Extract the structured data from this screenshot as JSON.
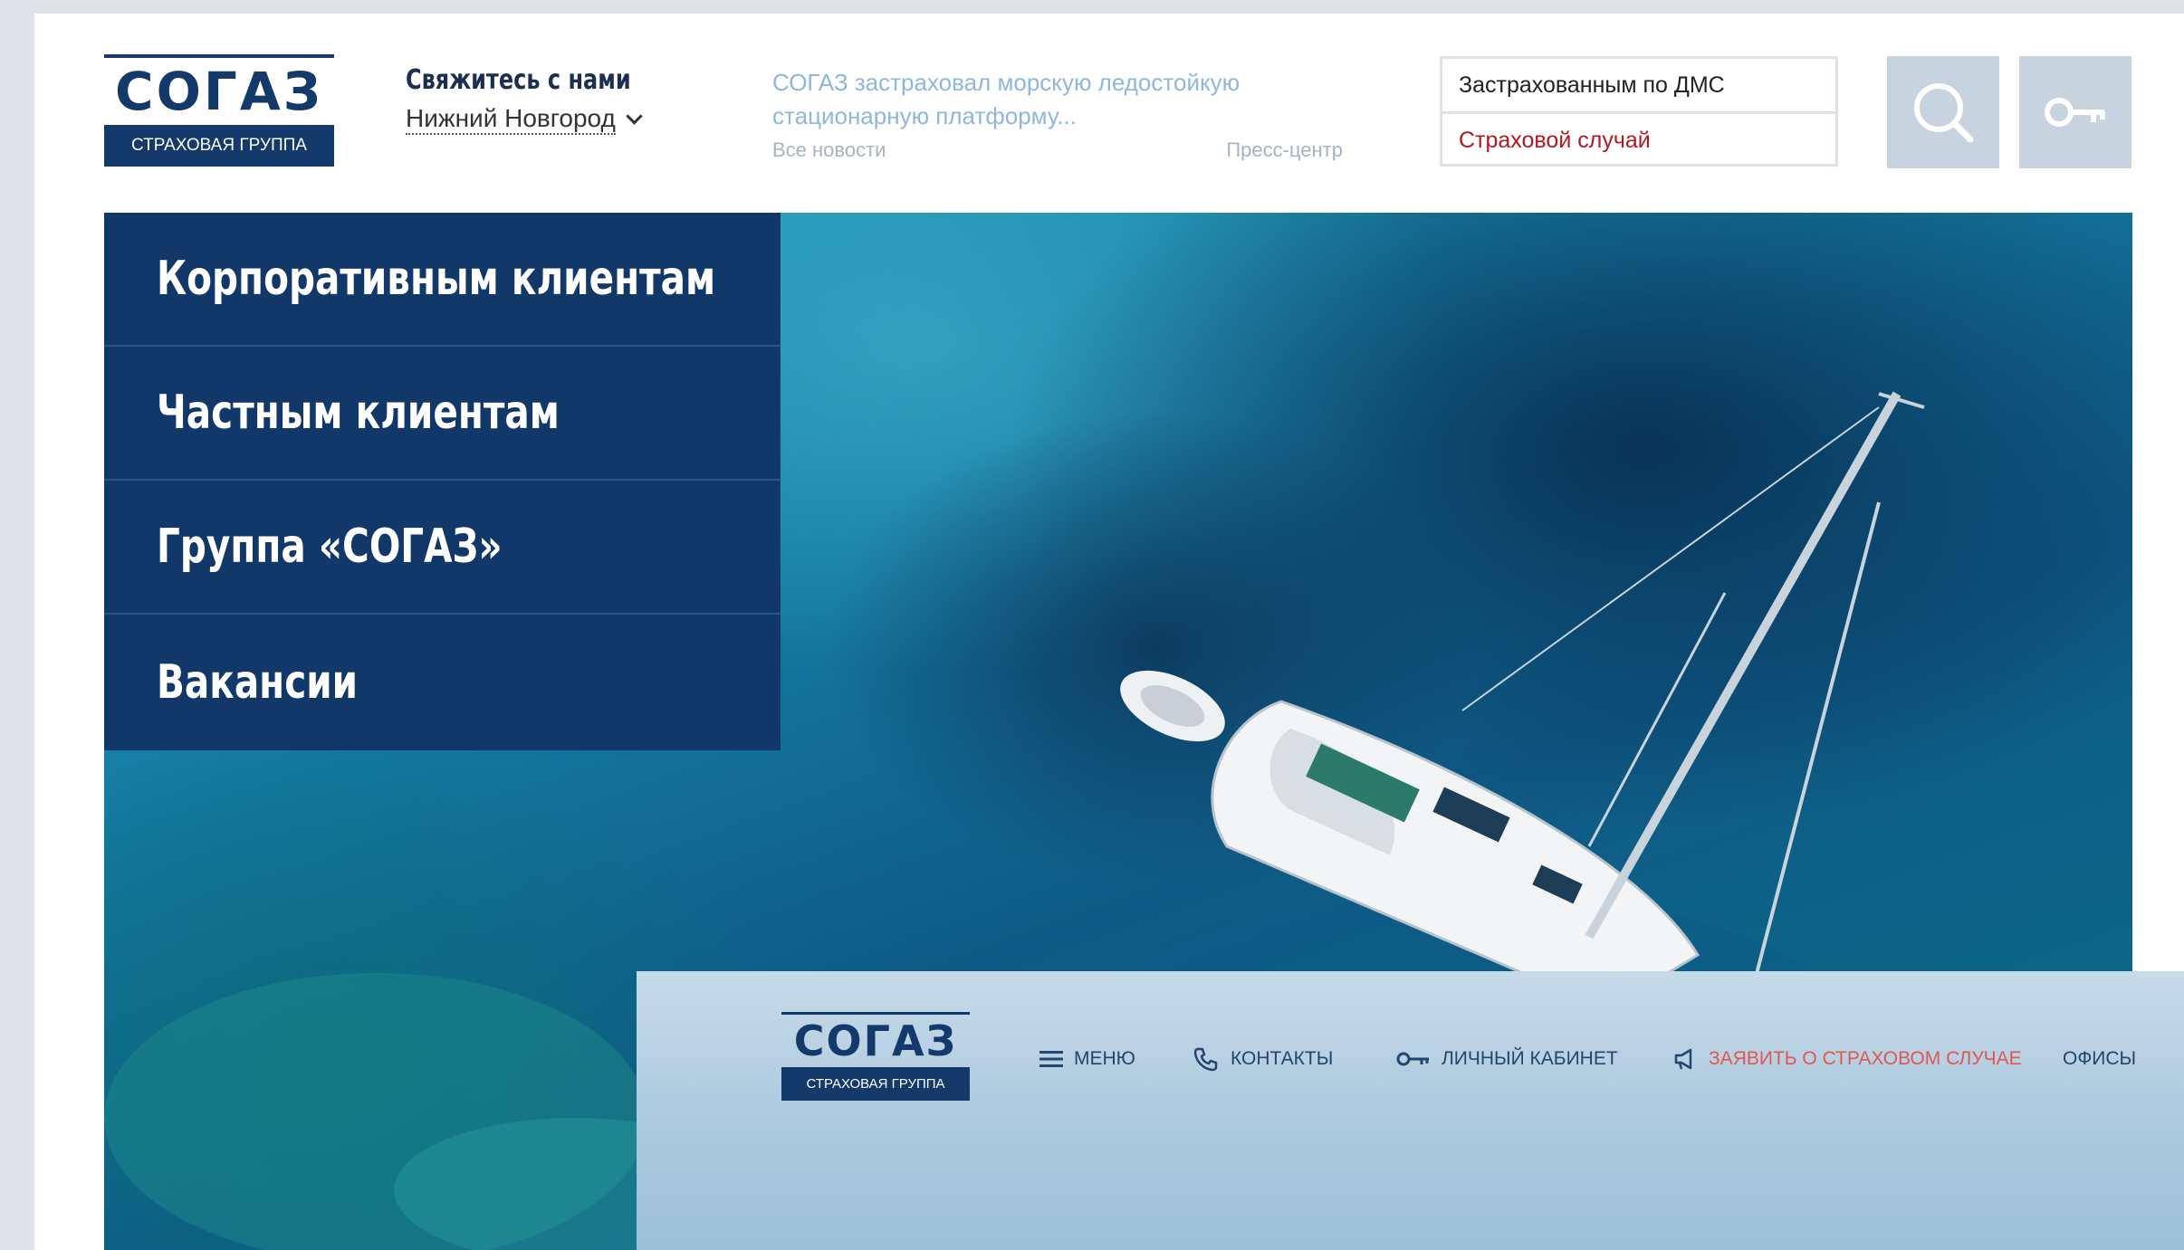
{
  "brand": {
    "name": "СОГАЗ",
    "tagline": "СТРАХОВАЯ ГРУППА"
  },
  "contact": {
    "title": "Свяжитесь с нами",
    "city": "Нижний Новгород"
  },
  "news": {
    "headline": "СОГАЗ застраховал морскую ледостойкую стационарную платформу...",
    "all_news": "Все новости",
    "press_center": "Пресс-центр"
  },
  "quick_links": {
    "dms": "Застрахованным по ДМС",
    "insured_event": "Страховой случай"
  },
  "main_menu": [
    {
      "label": "Корпоративным клиентам"
    },
    {
      "label": "Частным клиентам"
    },
    {
      "label": "Группа «СОГАЗ»"
    },
    {
      "label": "Вакансии"
    }
  ],
  "bottom_nav": {
    "menu": "МЕНЮ",
    "contacts": "КОНТАКТЫ",
    "cabinet": "ЛИЧНЫЙ КАБИНЕТ",
    "report": "ЗАЯВИТЬ О СТРАХОВОМ СЛУЧАЕ",
    "offices": "ОФИСЫ"
  },
  "icons": {
    "search": "search-icon",
    "key": "key-icon",
    "menu": "hamburger-icon",
    "phone": "phone-icon",
    "megaphone": "megaphone-icon"
  },
  "colors": {
    "brand_navy": "#133a6b",
    "menu_bg": "#12386a",
    "alert_red": "#b41822",
    "news_blue": "#8fb7db",
    "button_gray": "#c7d4df"
  }
}
